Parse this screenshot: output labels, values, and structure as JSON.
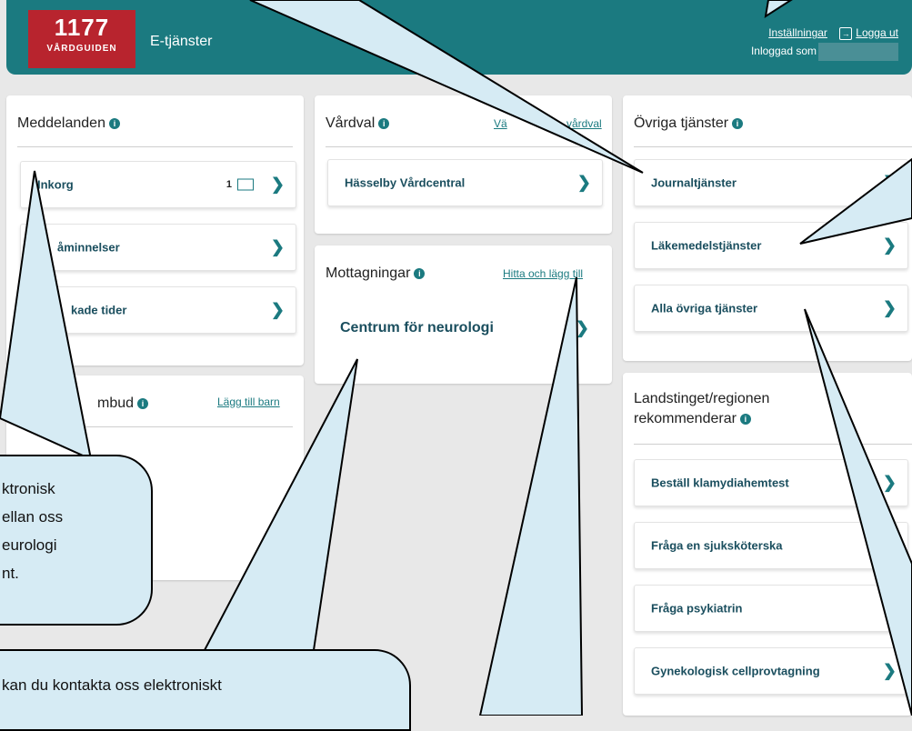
{
  "header": {
    "logo_number": "1177",
    "logo_sub": "VÅRDGUIDEN",
    "title": "E-tjänster",
    "settings": "Inställningar",
    "logout": "Logga ut",
    "logged_in_as": "Inloggad som"
  },
  "meddelanden": {
    "title": "Meddelanden",
    "items": [
      {
        "label": "Inkorg",
        "count": "1"
      },
      {
        "label": "åminnelser"
      },
      {
        "label": "kade tider"
      }
    ]
  },
  "ombud": {
    "title": "mbud",
    "link": "Lägg till barn"
  },
  "vardval": {
    "title": "Vårdval",
    "link_left": "Vä",
    "link_right": "vårdval",
    "item": "Hässelby Vårdcentral"
  },
  "mottagningar": {
    "title": "Mottagningar",
    "link": "Hitta och lägg till",
    "item": "Centrum för neurologi"
  },
  "ovriga": {
    "title": "Övriga tjänster",
    "items": [
      "Journaltjänster",
      "Läkemedelstjänster",
      "Alla övriga tjänster"
    ]
  },
  "landsting": {
    "title_line1": "Landstinget/regionen",
    "title_line2": "rekommenderar",
    "items": [
      "Beställ klamydiahemtest",
      "Fråga en sjuksköterska",
      "Fråga psykiatrin",
      "Gynekologisk cellprovtagning"
    ]
  },
  "callouts": {
    "left": [
      "ktronisk",
      "ellan oss",
      "eurologi",
      "nt."
    ],
    "bottom": "kan du kontakta oss elektroniskt"
  },
  "colors": {
    "header": "#1b7a80",
    "logo": "#b8242e",
    "callout": "#d6ebf4"
  }
}
